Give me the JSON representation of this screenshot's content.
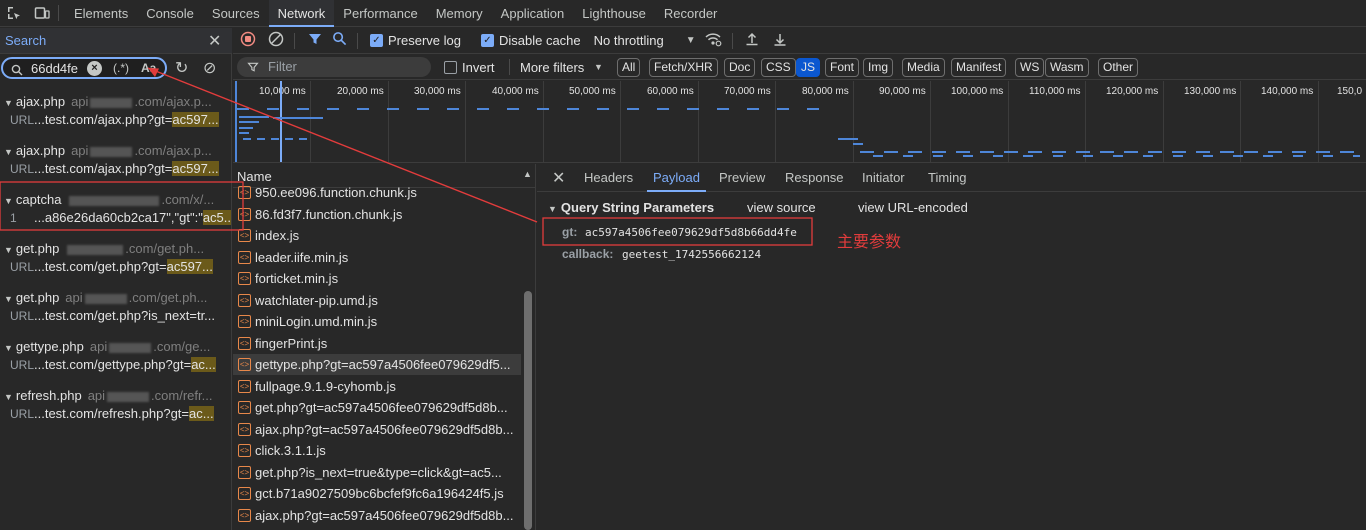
{
  "topbar": {
    "tabs": [
      "Elements",
      "Console",
      "Sources",
      "Network",
      "Performance",
      "Memory",
      "Application",
      "Lighthouse",
      "Recorder"
    ],
    "active_tab": "Network"
  },
  "search": {
    "title": "Search",
    "query": "66dd4fe",
    "regex_label": "(.*)",
    "case_label": "Aa",
    "results": [
      {
        "file": "ajax.php",
        "domain_pre": "api",
        "domain_post": ".com/ajax.p...",
        "line_label": "URL",
        "line_text": "...test.com/ajax.php?gt=",
        "line_match": "ac597..."
      },
      {
        "file": "ajax.php",
        "domain_pre": "api",
        "domain_post": ".com/ajax.p...",
        "line_label": "URL",
        "line_text": "...test.com/ajax.php?gt=",
        "line_match": "ac597..."
      },
      {
        "file": "captcha",
        "domain_pre": "",
        "domain_post": ".com/x/...",
        "line_label": "1",
        "line_text": "...a86e26da60cb2ca17\",\"gt\":\"",
        "line_match": "ac5..."
      },
      {
        "file": "get.php",
        "domain_pre": "",
        "domain_post": ".com/get.ph...",
        "line_label": "URL",
        "line_text": "...test.com/get.php?gt=",
        "line_match": "ac597..."
      },
      {
        "file": "get.php",
        "domain_pre": "api",
        "domain_post": ".com/get.ph...",
        "line_label": "URL",
        "line_text": "...test.com/get.php?is_next=tr...",
        "line_match": ""
      },
      {
        "file": "gettype.php",
        "domain_pre": "api",
        "domain_post": ".com/ge...",
        "line_label": "URL",
        "line_text": "...test.com/gettype.php?gt=",
        "line_match": "ac..."
      },
      {
        "file": "refresh.php",
        "domain_pre": "api",
        "domain_post": ".com/refr...",
        "line_label": "URL",
        "line_text": "...test.com/refresh.php?gt=",
        "line_match": "ac..."
      }
    ]
  },
  "toolbar": {
    "preserve_log": "Preserve log",
    "disable_cache": "Disable cache",
    "throttling": "No throttling"
  },
  "filterbar": {
    "placeholder": "Filter",
    "invert": "Invert",
    "more_filters": "More filters",
    "types": [
      "All",
      "Fetch/XHR",
      "Doc",
      "CSS",
      "JS",
      "Font",
      "Img",
      "Media",
      "Manifest",
      "WS",
      "Wasm",
      "Other"
    ],
    "selected_type": "JS"
  },
  "overview": {
    "ticks": [
      "10,000 ms",
      "20,000 ms",
      "30,000 ms",
      "40,000 ms",
      "50,000 ms",
      "60,000 ms",
      "70,000 ms",
      "80,000 ms",
      "90,000 ms",
      "100,000 ms",
      "110,000 ms",
      "120,000 ms",
      "130,000 ms",
      "140,000 ms",
      "150,0"
    ]
  },
  "requests": {
    "header": "Name",
    "items": [
      "950.ee096.function.chunk.js",
      "86.fd3f7.function.chunk.js",
      "index.js",
      "leader.iife.min.js",
      "forticket.min.js",
      "watchlater-pip.umd.js",
      "miniLogin.umd.min.js",
      "fingerPrint.js",
      "gettype.php?gt=ac597a4506fee079629df5...",
      "fullpage.9.1.9-cyhomb.js",
      "get.php?gt=ac597a4506fee079629df5d8b...",
      "ajax.php?gt=ac597a4506fee079629df5d8b...",
      "click.3.1.1.js",
      "get.php?is_next=true&type=click&gt=ac5...",
      "gct.b71a9027509bc6bcfef9fc6a196424f5.js",
      "ajax.php?gt=ac597a4506fee079629df5d8b..."
    ],
    "highlighted_index": 8
  },
  "details": {
    "tabs": [
      "Headers",
      "Payload",
      "Preview",
      "Response",
      "Initiator",
      "Timing"
    ],
    "active_tab": "Payload",
    "section_title": "Query String Parameters",
    "view_source": "view source",
    "view_url_encoded": "view URL-encoded",
    "params": [
      {
        "key": "gt:",
        "value": "ac597a4506fee079629df5d8b66dd4fe"
      },
      {
        "key": "callback:",
        "value": "geetest_1742556662124"
      }
    ],
    "annotation": "主要参数"
  },
  "colors": {
    "accent": "#7cacf8",
    "annotation_red": "#e23c3c",
    "match_highlight": "#6b5a1a",
    "script_icon": "#e8884a"
  }
}
